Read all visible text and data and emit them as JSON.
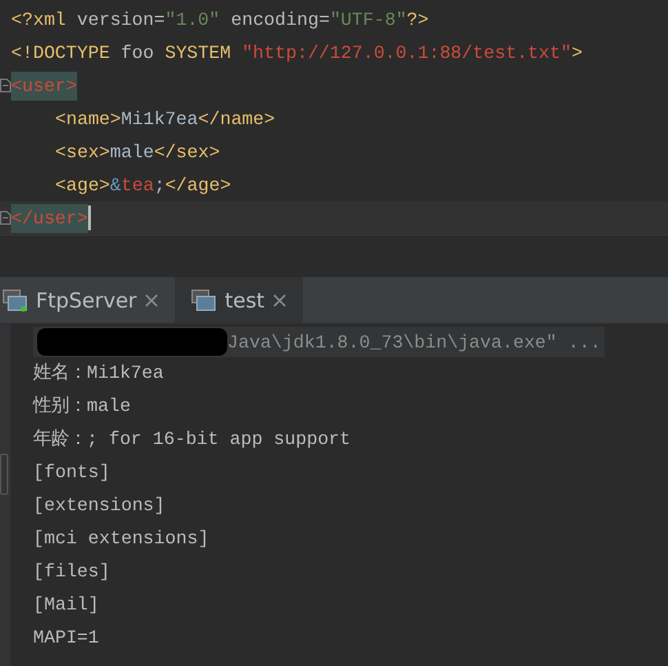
{
  "editor": {
    "lines": [
      {
        "fold": false,
        "current": false,
        "segments": [
          {
            "kind": "tag",
            "text": "<?xml "
          },
          {
            "kind": "attr",
            "text": "version="
          },
          {
            "kind": "string",
            "text": "\"1.0\""
          },
          {
            "kind": "attr",
            "text": " encoding="
          },
          {
            "kind": "string",
            "text": "\"UTF-8\""
          },
          {
            "kind": "tag",
            "text": "?>"
          }
        ]
      },
      {
        "fold": false,
        "current": false,
        "segments": [
          {
            "kind": "tag",
            "text": "<!DOCTYPE "
          },
          {
            "kind": "attr",
            "text": "foo "
          },
          {
            "kind": "tag",
            "text": "SYSTEM "
          },
          {
            "kind": "url",
            "text": "\"http://127.0.0.1:88/test.txt\""
          },
          {
            "kind": "tag",
            "text": ">"
          }
        ]
      },
      {
        "fold": true,
        "current": false,
        "segments": [
          {
            "kind": "matched",
            "text": "<user>"
          }
        ],
        "children": [
          {
            "fold": false,
            "current": false,
            "segments": [
              {
                "kind": "tag",
                "text": "<name>"
              },
              {
                "kind": "plain",
                "text": "Mi1k7ea"
              },
              {
                "kind": "tag",
                "text": "</name>"
              }
            ]
          },
          {
            "fold": false,
            "current": false,
            "segments": [
              {
                "kind": "tag",
                "text": "<sex>"
              },
              {
                "kind": "plain",
                "text": "male"
              },
              {
                "kind": "tag",
                "text": "</sex>"
              }
            ]
          },
          {
            "fold": false,
            "current": false,
            "segments": [
              {
                "kind": "tag",
                "text": "<age>"
              },
              {
                "kind": "entity",
                "text": "&"
              },
              {
                "kind": "url",
                "text": "tea"
              },
              {
                "kind": "plain",
                "text": ";"
              },
              {
                "kind": "tag",
                "text": "</age>"
              }
            ]
          }
        ]
      },
      {
        "fold": true,
        "current": true,
        "segments": [
          {
            "kind": "matched",
            "text": "</user>"
          }
        ]
      }
    ]
  },
  "run_tabs": [
    {
      "label": "FtpServer",
      "selected": false,
      "running": true
    },
    {
      "label": "test",
      "selected": true,
      "running": false
    }
  ],
  "console": {
    "command": "Java\\jdk1.8.0_73\\bin\\java.exe\" ...",
    "lines": [
      "姓名：Mi1k7ea",
      "性别：male",
      "年龄：; for 16-bit app support",
      "[fonts]",
      "[extensions]",
      "[mci extensions]",
      "[files]",
      "[Mail]",
      "MAPI=1"
    ]
  }
}
